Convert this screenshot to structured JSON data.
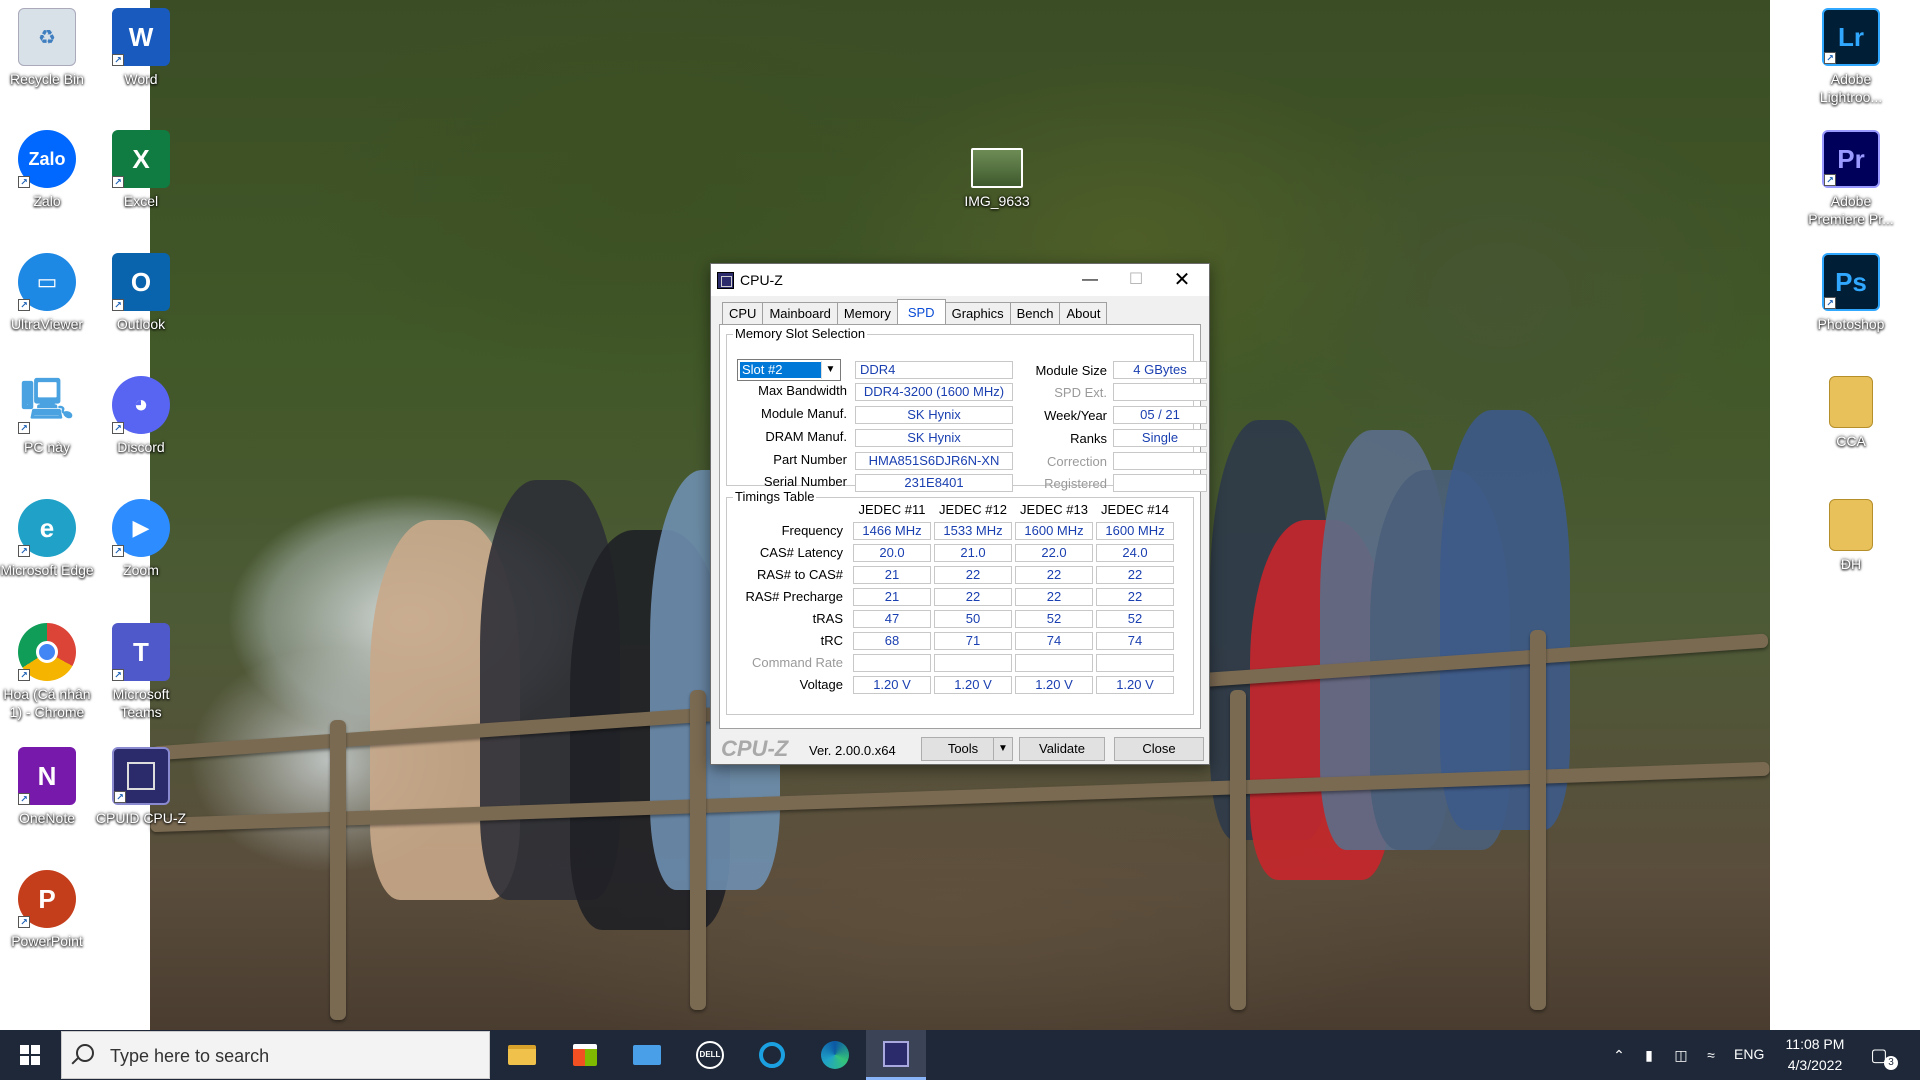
{
  "desktop": {
    "left_icons": [
      {
        "label": "Recycle Bin",
        "icon": "recycle-bin-icon",
        "color": "#c9d4de"
      },
      {
        "label": "Word",
        "icon": "word-icon",
        "color": "#185abd"
      },
      {
        "label": "Zalo",
        "icon": "zalo-icon",
        "color": "#0068ff"
      },
      {
        "label": "Excel",
        "icon": "excel-icon",
        "color": "#107c41"
      },
      {
        "label": "UltraViewer",
        "icon": "ultraviewer-icon",
        "color": "#1e88e5"
      },
      {
        "label": "Outlook",
        "icon": "outlook-icon",
        "color": "#0a64ad"
      },
      {
        "label": "PC này",
        "icon": "this-pc-icon",
        "color": "#4aa3e0"
      },
      {
        "label": "Discord",
        "icon": "discord-icon",
        "color": "#5865f2"
      },
      {
        "label": "Microsoft Edge",
        "icon": "edge-icon",
        "color": "#1fa1c8"
      },
      {
        "label": "Zoom",
        "icon": "zoom-icon",
        "color": "#2d8cff"
      },
      {
        "label": "Hoa (Cá nhân 1) - Chrome",
        "icon": "chrome-icon",
        "color": "#db4437"
      },
      {
        "label": "Microsoft Teams",
        "icon": "teams-icon",
        "color": "#5059c9"
      },
      {
        "label": "OneNote",
        "icon": "onenote-icon",
        "color": "#7719aa"
      },
      {
        "label": "CPUID CPU-Z",
        "icon": "cpuz-icon",
        "color": "#2b2b6b"
      },
      {
        "label": "PowerPoint",
        "icon": "powerpoint-icon",
        "color": "#c43e1c"
      }
    ],
    "right_icons": [
      {
        "label": "Adobe Lightroo...",
        "icon": "lightroom-icon",
        "color": "#001e36",
        "glyph": "Lr"
      },
      {
        "label": "Adobe Premiere Pr...",
        "icon": "premiere-icon",
        "color": "#00005b",
        "glyph": "Pr"
      },
      {
        "label": "Photoshop",
        "icon": "photoshop-icon",
        "color": "#001e36",
        "glyph": "Ps"
      },
      {
        "label": "CCA",
        "icon": "folder-icon",
        "color": "#e8c15a",
        "glyph": ""
      },
      {
        "label": "ĐH",
        "icon": "folder-icon",
        "color": "#e8c15a",
        "glyph": ""
      }
    ],
    "center_icon": {
      "label": "IMG_9633",
      "icon": "image-file-icon"
    },
    "glyphs": {
      "word": "W",
      "zalo": "Zalo",
      "excel": "X",
      "outlook": "O",
      "teams": "T",
      "onenote": "N",
      "powerpoint": "P"
    }
  },
  "cpuz": {
    "title": "CPU-Z",
    "tabs": [
      "CPU",
      "Mainboard",
      "Memory",
      "SPD",
      "Graphics",
      "Bench",
      "About"
    ],
    "active_tab": "SPD",
    "slot_group_title": "Memory Slot Selection",
    "slot_selected": "Slot #2",
    "memory_type": "DDR4",
    "left_fields": [
      {
        "label": "Max Bandwidth",
        "value": "DDR4-3200 (1600 MHz)"
      },
      {
        "label": "Module Manuf.",
        "value": "SK Hynix"
      },
      {
        "label": "DRAM Manuf.",
        "value": "SK Hynix"
      },
      {
        "label": "Part Number",
        "value": "HMA851S6DJR6N-XN"
      },
      {
        "label": "Serial Number",
        "value": "231E8401"
      }
    ],
    "right_fields": [
      {
        "label": "Module Size",
        "value": "4 GBytes",
        "dim": false
      },
      {
        "label": "SPD Ext.",
        "value": "",
        "dim": true
      },
      {
        "label": "Week/Year",
        "value": "05 / 21",
        "dim": false
      },
      {
        "label": "Ranks",
        "value": "Single",
        "dim": false
      },
      {
        "label": "Correction",
        "value": "",
        "dim": true
      },
      {
        "label": "Registered",
        "value": "",
        "dim": true
      }
    ],
    "timings_title": "Timings Table",
    "timing_columns": [
      "JEDEC #11",
      "JEDEC #12",
      "JEDEC #13",
      "JEDEC #14"
    ],
    "timing_rows": [
      {
        "label": "Frequency",
        "values": [
          "1466 MHz",
          "1533 MHz",
          "1600 MHz",
          "1600 MHz"
        ],
        "dim": false
      },
      {
        "label": "CAS# Latency",
        "values": [
          "20.0",
          "21.0",
          "22.0",
          "24.0"
        ],
        "dim": false
      },
      {
        "label": "RAS# to CAS#",
        "values": [
          "21",
          "22",
          "22",
          "22"
        ],
        "dim": false
      },
      {
        "label": "RAS# Precharge",
        "values": [
          "21",
          "22",
          "22",
          "22"
        ],
        "dim": false
      },
      {
        "label": "tRAS",
        "values": [
          "47",
          "50",
          "52",
          "52"
        ],
        "dim": false
      },
      {
        "label": "tRC",
        "values": [
          "68",
          "71",
          "74",
          "74"
        ],
        "dim": false
      },
      {
        "label": "Command Rate",
        "values": [
          "",
          "",
          "",
          ""
        ],
        "dim": true
      },
      {
        "label": "Voltage",
        "values": [
          "1.20 V",
          "1.20 V",
          "1.20 V",
          "1.20 V"
        ],
        "dim": false
      }
    ],
    "footer": {
      "brand": "CPU-Z",
      "version": "Ver. 2.00.0.x64",
      "tools_label": "Tools",
      "validate_label": "Validate",
      "close_label": "Close"
    }
  },
  "taskbar": {
    "search_placeholder": "Type here to search",
    "apps": [
      "file-explorer-icon",
      "microsoft-store-icon",
      "mail-icon",
      "dell-icon",
      "cortana-icon",
      "edge-icon",
      "cpuz-icon"
    ],
    "language": "ENG",
    "time": "11:08 PM",
    "date": "4/3/2022",
    "notification_count": "3"
  },
  "colors": {
    "accent": "#0078d7",
    "value_text": "#1a3fb0",
    "taskbar": "#1e2838"
  }
}
